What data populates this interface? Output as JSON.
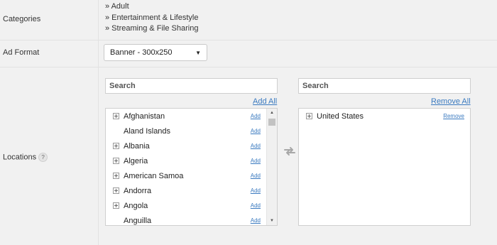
{
  "categories": {
    "label": "Categories",
    "items": [
      "» Adult",
      "» Entertainment & Lifestyle",
      "» Streaming & File Sharing"
    ]
  },
  "ad_format": {
    "label": "Ad Format",
    "selected": "Banner - 300x250"
  },
  "locations": {
    "label": "Locations",
    "help_glyph": "?",
    "available": {
      "search_placeholder": "Search",
      "add_all_label": "Add All",
      "items": [
        {
          "name": "Afghanistan",
          "expandable": true,
          "action": "Add"
        },
        {
          "name": "Aland Islands",
          "expandable": false,
          "action": "Add"
        },
        {
          "name": "Albania",
          "expandable": true,
          "action": "Add"
        },
        {
          "name": "Algeria",
          "expandable": true,
          "action": "Add"
        },
        {
          "name": "American Samoa",
          "expandable": true,
          "action": "Add"
        },
        {
          "name": "Andorra",
          "expandable": true,
          "action": "Add"
        },
        {
          "name": "Angola",
          "expandable": true,
          "action": "Add"
        },
        {
          "name": "Anguilla",
          "expandable": false,
          "action": "Add"
        }
      ]
    },
    "selected": {
      "search_placeholder": "Search",
      "remove_all_label": "Remove All",
      "items": [
        {
          "name": "United States",
          "expandable": true,
          "action": "Remove"
        }
      ]
    },
    "swap_icon": "swap-arrows-icon"
  },
  "colors": {
    "link": "#3a7ac0",
    "background": "#f1f1f1"
  }
}
